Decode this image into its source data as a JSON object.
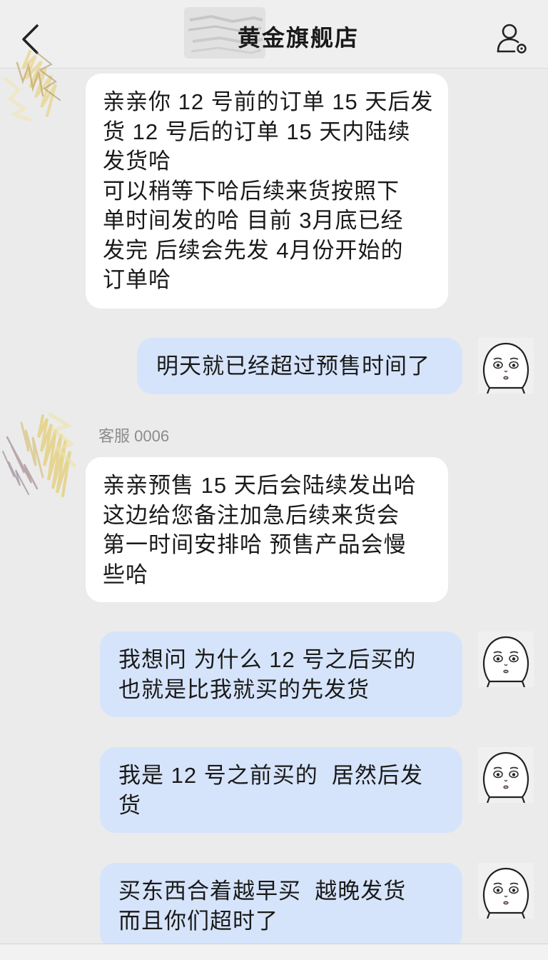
{
  "header": {
    "title": "黄金旗舰店"
  },
  "icons": {
    "back": "chevron-left-icon",
    "profile": "user-settings-icon",
    "my_avatar": "cartoon-face-avatar"
  },
  "messages": [
    {
      "outgoing": false,
      "lines": [
        "亲亲你 12 号前的订单 15 天后发",
        "货 12 号后的订单 15 天内陆续",
        "发货哈",
        "可以稍等下哈后续来货按照下",
        "单时间发的哈 目前 3月底已经",
        "发完 后续会先发 4月份开始的",
        "订单哈"
      ]
    },
    {
      "outgoing": true,
      "lines": [
        "明天就已经超过预售时间了"
      ]
    },
    {
      "outgoing": false,
      "sender": "客服 0006",
      "lines": [
        "亲亲预售 15 天后会陆续发出哈",
        "这边给您备注加急后续来货会",
        "第一时间安排哈 预售产品会慢",
        "些哈"
      ]
    },
    {
      "outgoing": true,
      "lines": [
        "我想问 为什么 12 号之后买的",
        "也就是比我就买的先发货"
      ]
    },
    {
      "outgoing": true,
      "lines": [
        "我是 12 号之前买的  居然后发",
        "货"
      ]
    },
    {
      "outgoing": true,
      "lines": [
        "买东西合着越早买  越晚发货",
        "而且你们超时了"
      ]
    }
  ],
  "colors": {
    "background": "#ebebeb",
    "incoming_bubble": "#ffffff",
    "outgoing_bubble": "#d6e4fb",
    "text": "#1a1a1a",
    "sender_label": "#8c8c8c"
  }
}
